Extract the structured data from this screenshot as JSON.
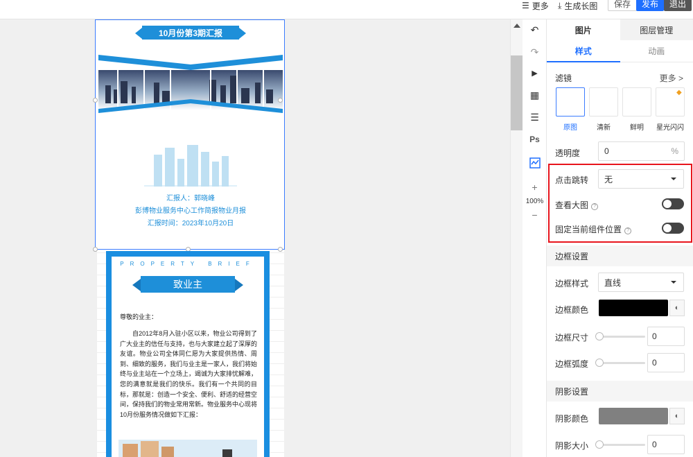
{
  "topbar": {
    "more_label": "更多",
    "long_image_label": "生成长图",
    "save_label": "保存",
    "publish_label": "发布",
    "exit_label": "退出"
  },
  "page1": {
    "ribbon_title": "10月份第3期汇报",
    "reporter": "汇报人：郭晓峰",
    "subtitle": "彭博物业服务中心工作简报物业月报",
    "report_time": "汇报时间：2023年10月20日"
  },
  "page2": {
    "brief": "PROPERTY BRIEF",
    "ribbon_title": "致业主",
    "greeting": "尊敬的业主：",
    "body": "自2012年8月入驻小区以来，物业公司得到了广大业主的信任与支持，也与大家建立起了深厚的友谊。物业公司全体同仁愿为大家提供热情、周到、细致的服务，我们与业主是一家人，我们将始终与业主站在一个立场上，竭诚为大家排忧解难，您的满意就是我们的快乐。我们有一个共同的目标，那就是：创造一个安全、便利、舒适的经营空间，保持我们的物业常用常新。物业服务中心现将10月份服务情况做如下汇报："
  },
  "tools": {
    "ps_label": "Ps",
    "zoom_plus": "+",
    "zoom_level": "100%",
    "zoom_minus": "−"
  },
  "panel": {
    "tab_image": "图片",
    "tab_layers": "图层管理",
    "subtab_style": "样式",
    "subtab_animation": "动画",
    "filter_label": "滤镜",
    "filter_more": "更多 >",
    "filters": [
      "原图",
      "清新",
      "鲜明",
      "星光闪闪"
    ],
    "opacity_label": "透明度",
    "opacity_value": "0",
    "opacity_unit": "%",
    "click_jump_label": "点击跳转",
    "click_jump_value": "无",
    "view_large_label": "查看大图",
    "fix_position_label": "固定当前组件位置",
    "border_section": "边框设置",
    "border_style_label": "边框样式",
    "border_style_value": "直线",
    "border_color_label": "边框颜色",
    "border_size_label": "边框尺寸",
    "border_size_value": "0",
    "border_radius_label": "边框弧度",
    "border_radius_value": "0",
    "shadow_section": "阴影设置",
    "shadow_color_label": "阴影颜色",
    "shadow_size_label": "阴影大小",
    "shadow_size_value": "0"
  },
  "colors": {
    "accent": "#1e6fff",
    "publish": "#1e6fff",
    "exit": "#555555",
    "border_color": "#000000",
    "shadow_color": "#808080",
    "highlight": "#e8141c"
  }
}
